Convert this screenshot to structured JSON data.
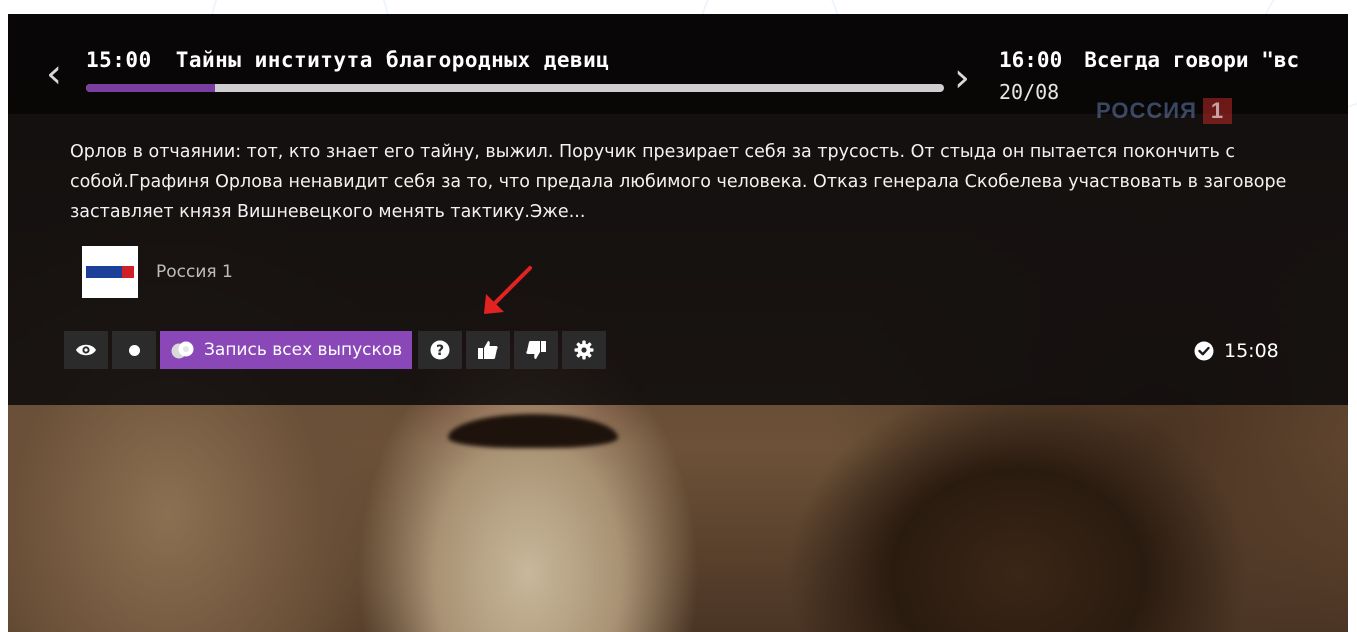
{
  "program": {
    "time": "15:00",
    "title": "Тайны института благородных девиц",
    "progress": 0.15
  },
  "next_program": {
    "time": "16:00",
    "title": "Всегда говори \"вс",
    "date": "20/08"
  },
  "background_logo": {
    "text": "РОССИЯ",
    "number": "1"
  },
  "description": "Орлов в отчаянии: тот, кто знает его тайну, выжил. Поручик презирает себя за трусость. От стыда он пытается покончить с собой.Графиня Орлова ненавидит себя за то, что предала любимого человека. Отказ генерала Скобелева участвовать в заговоре заставляет князя Вишневецкого менять тактику.Эже...",
  "channel": {
    "name": "Россия 1",
    "logo_icon": "russia-1-logo-icon"
  },
  "controls": {
    "watch_icon": "eye-icon",
    "record_icon": "record-dot-icon",
    "record_all_label": "Запись всех выпусков",
    "record_all_icon": "series-record-icon",
    "help_icon": "question-icon",
    "like_icon": "thumbs-up-icon",
    "dislike_icon": "thumbs-down-icon",
    "settings_icon": "gear-icon"
  },
  "clock": {
    "time": "15:08",
    "icon": "check-circle-icon"
  },
  "colors": {
    "accent_purple": "#8a47b8",
    "progress_fill": "#7a3ea0",
    "annotation_red": "#e32322"
  }
}
